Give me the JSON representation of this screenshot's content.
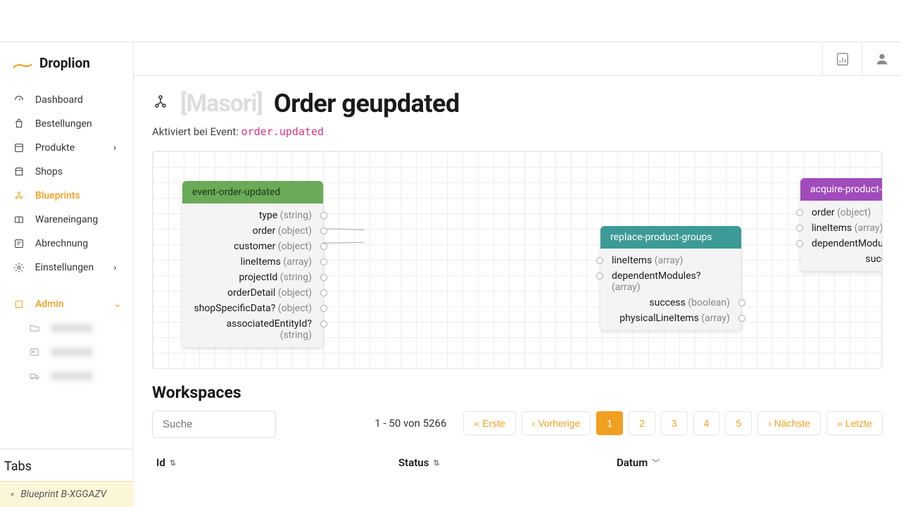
{
  "app_name": "Droplion",
  "sidebar": {
    "items": [
      {
        "icon": "dashboard",
        "label": "Dashboard"
      },
      {
        "icon": "orders",
        "label": "Bestellungen"
      },
      {
        "icon": "products",
        "label": "Produkte",
        "expandable": true
      },
      {
        "icon": "shops",
        "label": "Shops"
      },
      {
        "icon": "blueprints",
        "label": "Blueprints",
        "active": true
      },
      {
        "icon": "incoming",
        "label": "Wareneingang"
      },
      {
        "icon": "billing",
        "label": "Abrechnung"
      },
      {
        "icon": "settings",
        "label": "Einstellungen",
        "expandable": true
      }
    ],
    "admin_label": "Admin"
  },
  "tabs": {
    "heading": "Tabs",
    "item": "Blueprint B-XGGAZV"
  },
  "page": {
    "redacted": "[Masori]",
    "title": "Order geupdated",
    "subtitle_prefix": "Aktiviert bei Event: ",
    "event": "order.updated"
  },
  "nodes": {
    "n1": {
      "title": "event-order-updated",
      "props": [
        {
          "name": "type",
          "type": "(string)"
        },
        {
          "name": "order",
          "type": "(object)"
        },
        {
          "name": "customer",
          "type": "(object)"
        },
        {
          "name": "lineItems",
          "type": "(array)"
        },
        {
          "name": "projectId",
          "type": "(string)"
        },
        {
          "name": "orderDetail",
          "type": "(object)"
        },
        {
          "name": "shopSpecificData?",
          "type": "(object)"
        },
        {
          "name": "associatedEntityId?",
          "type": "(string)"
        }
      ]
    },
    "n2": {
      "title": "replace-product-groups",
      "props": [
        {
          "name": "lineItems",
          "type": "(array)",
          "side": "left"
        },
        {
          "name": "dependentModules?",
          "type": "(array)",
          "side": "left"
        },
        {
          "name": "success",
          "type": "(boolean)",
          "side": "right"
        },
        {
          "name": "physicalLineItems",
          "type": "(array)",
          "side": "right"
        }
      ]
    },
    "n3": {
      "title": "acquire-product-",
      "props": [
        {
          "name": "order",
          "type": "(object)",
          "side": "left"
        },
        {
          "name": "lineItems",
          "type": "(array)",
          "side": "left"
        },
        {
          "name": "dependentModu",
          "type": "",
          "side": "left"
        },
        {
          "name": "success",
          "type": "",
          "side": "right-text"
        }
      ]
    }
  },
  "workspaces": {
    "title": "Workspaces",
    "search_placeholder": "Suche",
    "range": "1  - 50 von 5266",
    "pages": {
      "first": "« Erste",
      "prev": "‹ Vorherige",
      "nums": [
        "1",
        "2",
        "3",
        "4",
        "5"
      ],
      "next": "› Nächste",
      "last": "» Letzte"
    },
    "columns": {
      "id": "Id",
      "status": "Status",
      "date": "Datum"
    }
  }
}
